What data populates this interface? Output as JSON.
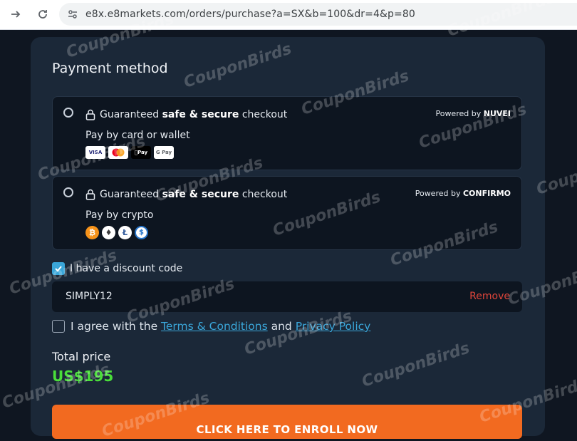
{
  "browser": {
    "url": "e8x.e8markets.com/orders/purchase?a=SX&b=100&dr=4&p=80"
  },
  "payment": {
    "title": "Payment method",
    "methods": [
      {
        "secure_prefix": "Guaranteed ",
        "secure_bold": "safe & secure",
        "secure_suffix": " checkout",
        "powered_prefix": "Powered by ",
        "powered_name": "NUVEI",
        "label": "Pay by card or wallet",
        "badges": [
          "VISA",
          "Mastercard",
          "Apple Pay",
          "G Pay"
        ]
      },
      {
        "secure_prefix": "Guaranteed ",
        "secure_bold": "safe & secure",
        "secure_suffix": " checkout",
        "powered_prefix": "Powered by ",
        "powered_name": "CONFIRMO",
        "label": "Pay by crypto",
        "coins": [
          "bitcoin-icon",
          "ethereum-icon",
          "litecoin-icon",
          "usd-coin-icon"
        ]
      }
    ],
    "discount": {
      "label": "I have a discount code",
      "checked": true,
      "code": "SIMPLY12",
      "remove_label": "Remove"
    },
    "terms": {
      "prefix": "I agree with the ",
      "terms_link": "Terms & Conditions",
      "middle": " and ",
      "privacy_link": "Privacy Policy",
      "checked": false
    },
    "total": {
      "label": "Total price",
      "value": "US$195"
    },
    "cta_label": "CLICK HERE TO ENROLL NOW"
  },
  "watermark": "CouponBirds",
  "colors": {
    "accent": "#3aa6d9",
    "cta": "#f26a20",
    "price": "#4ade3a",
    "remove": "#e0453a"
  }
}
